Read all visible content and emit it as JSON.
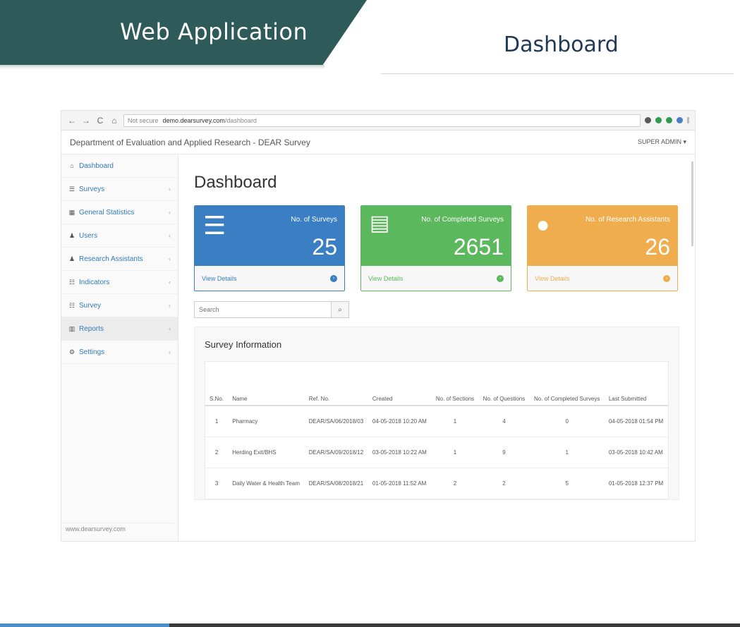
{
  "slide": {
    "title": "Web Application",
    "right_title": "Dashboard"
  },
  "browser": {
    "back": "←",
    "forward": "→",
    "reload": "C",
    "home": "⌂",
    "security": "Not secure",
    "url_host": "demo.dearsurvey.com",
    "url_path": "/dashboard"
  },
  "app": {
    "header_title": "Department of Evaluation and Applied Research - DEAR Survey",
    "user": "SUPER ADMIN ▾",
    "footer": "www.dearsurvey.com"
  },
  "sidebar": {
    "items": [
      {
        "label": "Dashboard",
        "icon": "⌂",
        "chevron": ""
      },
      {
        "label": "Surveys",
        "icon": "☰",
        "chevron": "‹"
      },
      {
        "label": "General Statistics",
        "icon": "▦",
        "chevron": "‹"
      },
      {
        "label": "Users",
        "icon": "♟",
        "chevron": "‹"
      },
      {
        "label": "Research Assistants",
        "icon": "♟",
        "chevron": "‹"
      },
      {
        "label": "Indicators",
        "icon": "☷",
        "chevron": "‹"
      },
      {
        "label": "Survey",
        "icon": "☷",
        "chevron": "‹"
      },
      {
        "label": "Reports",
        "icon": "▥",
        "chevron": "‹"
      },
      {
        "label": "Settings",
        "icon": "⚙",
        "chevron": "‹"
      }
    ]
  },
  "main": {
    "title": "Dashboard",
    "cards": [
      {
        "label": "No. of Surveys",
        "value": "25",
        "footer": "View Details",
        "color": "#3a7ec4",
        "icon": "list-icon"
      },
      {
        "label": "No. of Completed Surveys",
        "value": "2651",
        "footer": "View Details",
        "color": "#5cb85c",
        "icon": "server-icon"
      },
      {
        "label": "No. of Research Assistants",
        "value": "26",
        "footer": "View Details",
        "color": "#f0ad4e",
        "icon": "user-icon"
      }
    ],
    "search": {
      "placeholder": "Search"
    },
    "panel_title": "Survey Information",
    "table": {
      "headers": [
        "S.No.",
        "Name",
        "Ref. No.",
        "Created",
        "No. of Sections",
        "No. of Questions",
        "No. of Completed Surveys",
        "Last Submitted"
      ],
      "rows": [
        [
          "1",
          "Pharmacy",
          "DEAR/SA/06/2018/03",
          "04-05-2018 10:20 AM",
          "1",
          "4",
          "0",
          "04-05-2018 01:54 PM"
        ],
        [
          "2",
          "Herding Exit/BHS",
          "DEAR/SA/09/2018/12",
          "03-05-2018 10:22 AM",
          "1",
          "9",
          "1",
          "03-05-2018 10:42 AM"
        ],
        [
          "3",
          "Daily Water & Health Team",
          "DEAR/SA/08/2018/21",
          "01-05-2018 11:52 AM",
          "2",
          "2",
          "5",
          "01-05-2018 12:37 PM"
        ]
      ]
    }
  }
}
